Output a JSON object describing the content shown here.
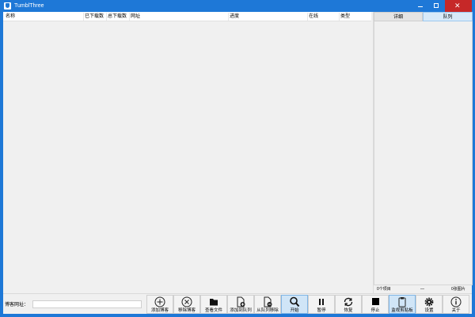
{
  "window": {
    "title": "TumblThree"
  },
  "blog_list": {
    "columns": [
      {
        "label": "名称"
      },
      {
        "label": "已下载数"
      },
      {
        "label": "总下载数"
      },
      {
        "label": "网址"
      },
      {
        "label": "进度"
      },
      {
        "label": "在线"
      },
      {
        "label": "类型"
      }
    ]
  },
  "side_panel": {
    "tabs": [
      {
        "label": "详细"
      },
      {
        "label": "队列"
      }
    ],
    "footer": {
      "items_count": "0个项目",
      "separator": "—",
      "images_count": "0张图片"
    }
  },
  "url_field": {
    "label": "博客网址：",
    "value": ""
  },
  "toolbar": {
    "buttons": [
      {
        "label": "添加博客",
        "icon": "plus-circle-icon"
      },
      {
        "label": "移除博客",
        "icon": "x-circle-icon"
      },
      {
        "label": "查看文件",
        "icon": "folder-icon"
      },
      {
        "label": "添加到队列",
        "icon": "document-add-icon"
      },
      {
        "label": "从队列移除",
        "icon": "document-remove-icon"
      },
      {
        "label": "开始",
        "icon": "magnifier-icon"
      },
      {
        "label": "暂停",
        "icon": "pause-icon"
      },
      {
        "label": "恢复",
        "icon": "refresh-icon"
      },
      {
        "label": "停止",
        "icon": "stop-icon"
      },
      {
        "label": "监视剪贴板",
        "icon": "clipboard-icon"
      },
      {
        "label": "设置",
        "icon": "gear-icon"
      },
      {
        "label": "关于",
        "icon": "info-icon"
      }
    ]
  },
  "colors": {
    "titlebar": "#1e78d7",
    "close": "#c62828",
    "active_button": "#d0e5f7"
  }
}
